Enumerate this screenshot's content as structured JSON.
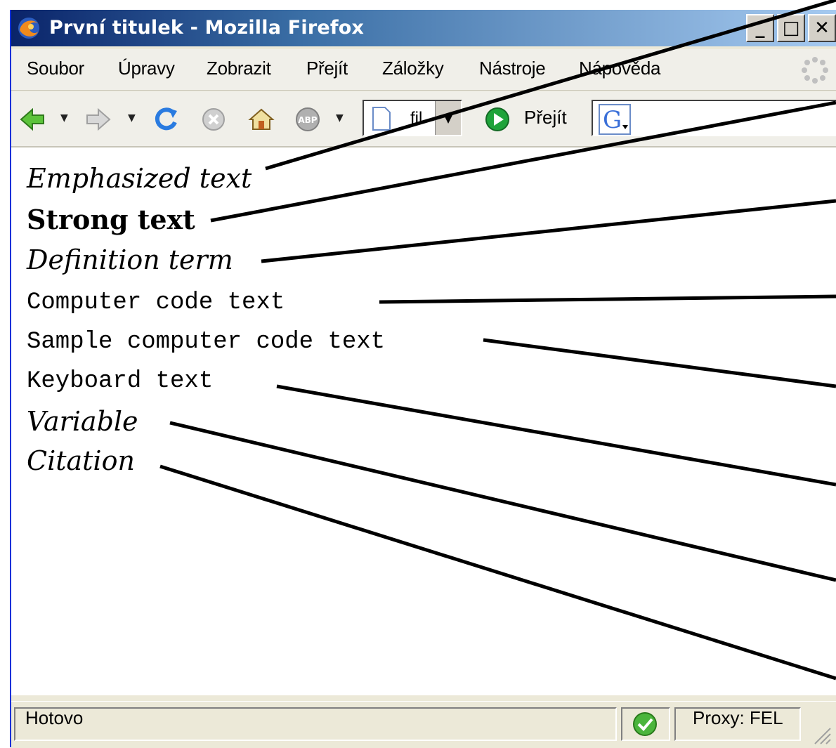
{
  "window": {
    "title": "První titulek - Mozilla Firefox",
    "buttons": {
      "minimize": "_",
      "maximize": "□",
      "close": "✕"
    }
  },
  "menubar": {
    "items": [
      "Soubor",
      "Úpravy",
      "Zobrazit",
      "Přejít",
      "Záložky",
      "Nástroje",
      "Nápověda"
    ]
  },
  "toolbar": {
    "url_value": "fil",
    "go_label": "Přejít",
    "adblock_label": "ABP"
  },
  "content": {
    "lines": [
      "Emphasized text",
      "Strong text",
      "Definition term",
      "Computer code text",
      "Sample computer code text",
      "Keyboard text",
      "Variable",
      "Citation"
    ]
  },
  "statusbar": {
    "status": "Hotovo",
    "proxy": "Proxy: FEL"
  },
  "colors": {
    "title_gradient_start": "#0a246a",
    "title_gradient_end": "#a6caf0",
    "chrome": "#ece9d8",
    "go_green": "#1fa33a",
    "back_green": "#5cc33b"
  }
}
